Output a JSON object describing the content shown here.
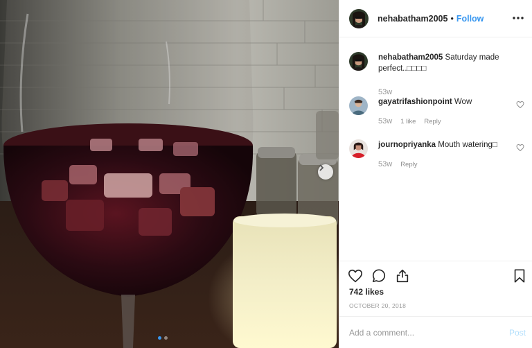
{
  "post": {
    "photo_alt": "",
    "carousel": {
      "count": 2,
      "active": 0
    }
  },
  "header": {
    "username": "nehabatham2005",
    "separator": "•",
    "follow_label": "Follow",
    "more_icon": "more-options-icon"
  },
  "comments": [
    {
      "username": "nehabatham2005",
      "text": "Saturday made perfect..□□□□",
      "time": "53w",
      "likes": "",
      "reply": ""
    },
    {
      "username": "gayatrifashionpoint",
      "text": "Wow",
      "time": "53w",
      "likes": "1 like",
      "reply": "Reply"
    },
    {
      "username": "journopriyanka",
      "text": "Mouth watering□",
      "time": "53w",
      "likes": "",
      "reply": "Reply"
    }
  ],
  "actions": {
    "like_icon": "heart-icon",
    "comment_icon": "comment-icon",
    "share_icon": "share-icon",
    "save_icon": "bookmark-icon"
  },
  "likes_text": "742 likes",
  "date_text": "OCTOBER 20, 2018",
  "composer": {
    "placeholder": "Add a comment...",
    "post_label": "Post"
  },
  "colors": {
    "link": "#3897f0",
    "post_disabled": "#b2dffc",
    "muted": "#999999"
  }
}
